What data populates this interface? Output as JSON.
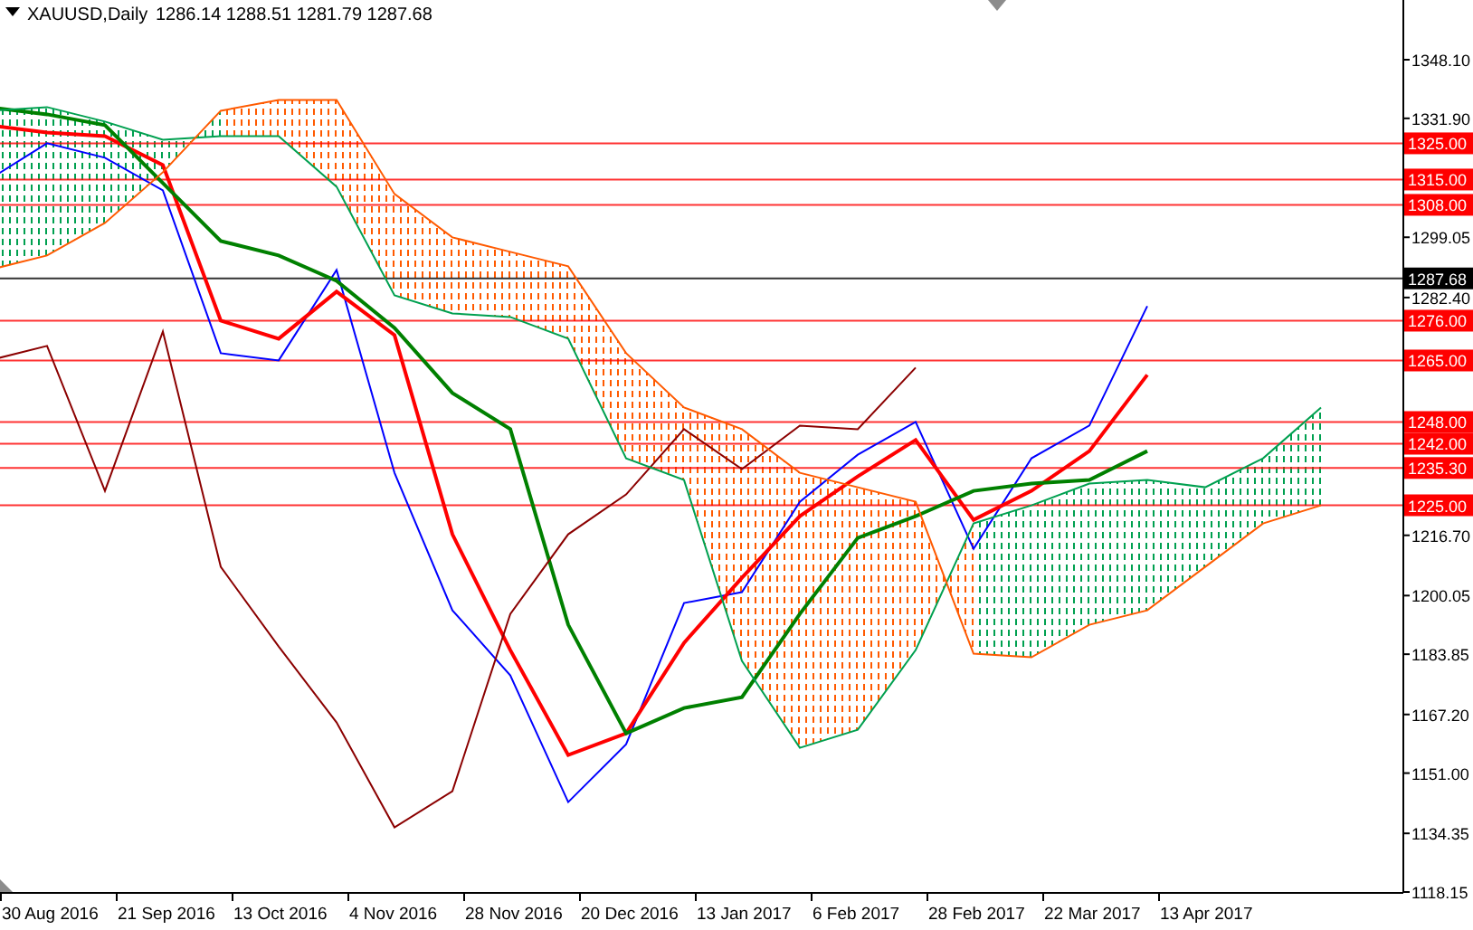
{
  "header": {
    "symbol": "XAUUSD,Daily",
    "ohlc": "1286.14 1288.51 1281.79 1287.68"
  },
  "chart_data": {
    "type": "line",
    "categories": [
      null,
      "30 Aug 2016",
      null,
      "21 Sep 2016",
      null,
      "13 Oct 2016",
      null,
      "4 Nov 2016",
      null,
      "28 Nov 2016",
      null,
      "20 Dec 2016",
      null,
      "13 Jan 2017",
      null,
      "6 Feb 2017",
      null,
      "28 Feb 2017",
      null,
      "22 Mar 2017",
      null,
      "13 Apr 2017",
      null,
      null
    ],
    "ylim": [
      1118.15,
      1364.6
    ],
    "yticks": [
      {
        "value": 1348.1,
        "label": "1348.10"
      },
      {
        "value": 1331.9,
        "label": "1331.90"
      },
      {
        "value": 1299.05,
        "label": "1299.05"
      },
      {
        "value": 1282.4,
        "label": "1282.40"
      },
      {
        "value": 1216.7,
        "label": "1216.70"
      },
      {
        "value": 1200.05,
        "label": "1200.05"
      },
      {
        "value": 1183.85,
        "label": "1183.85"
      },
      {
        "value": 1167.2,
        "label": "1167.20"
      },
      {
        "value": 1151,
        "label": "1151.00"
      },
      {
        "value": 1134.35,
        "label": "1134.35"
      },
      {
        "value": 1118.15,
        "label": "1118.15"
      }
    ],
    "series": [
      {
        "color": "#0000ff",
        "values": [
          1315,
          1325,
          1321,
          1312,
          1267,
          1265,
          1290,
          1234,
          1196,
          1178,
          1143,
          1159,
          1198,
          1201,
          1226,
          1239,
          1248,
          1213,
          1238,
          1247,
          1280,
          null,
          null,
          null
        ]
      },
      {
        "color": "#ff0000",
        "values": [
          1330,
          1328,
          1327,
          1319,
          1276,
          1271,
          1284,
          1272,
          1217,
          1185,
          1156,
          1162,
          1187,
          1205,
          1222,
          1233,
          1243,
          1221,
          1229,
          1240,
          1261,
          null,
          null,
          null
        ]
      },
      {
        "color": "#008000",
        "values": [
          1335,
          1333,
          1330,
          1314,
          1298,
          1294,
          1287,
          1274,
          1256,
          1246,
          1192,
          1162,
          1169,
          1172,
          1195,
          1216,
          1222,
          1229,
          1231,
          1232,
          1240,
          null,
          null,
          null
        ]
      },
      {
        "color": "#8b0000",
        "values": [
          1265,
          1269,
          1229,
          1273,
          1208,
          1186,
          1165,
          1136,
          1146,
          1195,
          1217,
          1228,
          1246,
          1235,
          1247,
          1246,
          1263,
          null,
          null,
          null,
          null,
          null,
          null,
          null
        ]
      },
      {
        "color": "#00a050",
        "values": [
          1334,
          1335,
          1331,
          1326,
          1327,
          1327,
          1313,
          1283,
          1278,
          1277,
          1271,
          1238,
          1232,
          1182,
          1158,
          1163,
          1185,
          1220,
          1225,
          1231,
          1232,
          1230,
          1238,
          1252
        ]
      },
      {
        "color": "#ff5a00",
        "values": [
          1290,
          1294,
          1303,
          1317,
          1334,
          1337,
          1337,
          1311,
          1299,
          1295,
          1291,
          1267,
          1252,
          1246,
          1234,
          1230,
          1226,
          1184,
          1183,
          1192,
          1196,
          1208,
          1220,
          1225
        ]
      }
    ],
    "ref_lines": [
      {
        "axis": "y",
        "value": 1325,
        "label": "1325.00",
        "color": "#ff0000"
      },
      {
        "axis": "y",
        "value": 1315,
        "label": "1315.00",
        "color": "#ff0000"
      },
      {
        "axis": "y",
        "value": 1308,
        "label": "1308.00",
        "color": "#ff0000"
      },
      {
        "axis": "y",
        "value": 1287.68,
        "label": "1287.68",
        "color": "#000000"
      },
      {
        "axis": "y",
        "value": 1276,
        "label": "1276.00",
        "color": "#ff0000"
      },
      {
        "axis": "y",
        "value": 1265,
        "label": "1265.00",
        "color": "#ff0000"
      },
      {
        "axis": "y",
        "value": 1248,
        "label": "1248.00",
        "color": "#ff0000"
      },
      {
        "axis": "y",
        "value": 1242,
        "label": "1242.00",
        "color": "#ff0000"
      },
      {
        "axis": "y",
        "value": 1235.3,
        "label": "1235.30",
        "color": "#ff0000"
      },
      {
        "axis": "y",
        "value": 1225,
        "label": "1225.00",
        "color": "#ff0000"
      }
    ]
  }
}
